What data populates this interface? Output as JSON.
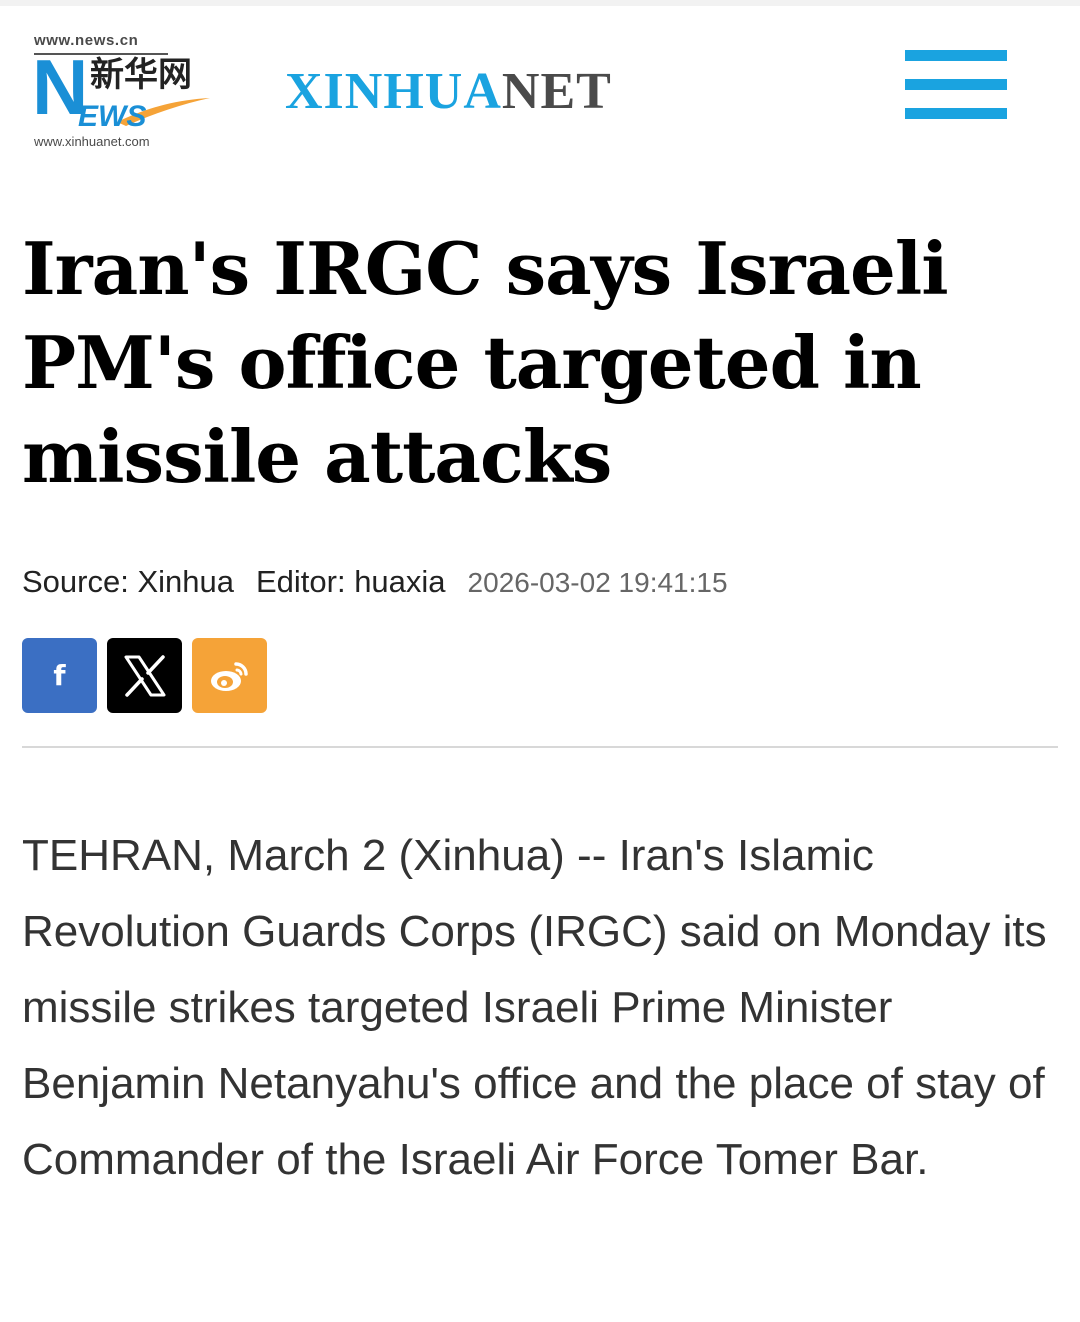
{
  "header": {
    "logo": {
      "url_top": "www.news.cn",
      "letter": "N",
      "chinese": "新华网",
      "ews": "EWS",
      "url_bottom": "www.xinhuanet.com"
    },
    "brand": {
      "part1": "XINHUA",
      "part2": "NET"
    },
    "menu_icon": "hamburger-menu-icon",
    "colors": {
      "accent": "#1aa3e0",
      "brand_gray": "#4a4a4a"
    }
  },
  "article": {
    "title": "Iran's IRGC says Israeli PM's office targeted in missile attacks",
    "source": "Source: Xinhua",
    "editor": "Editor: huaxia",
    "date": "2026-03-02 19:41:15",
    "body": "TEHRAN, March 2 (Xinhua) -- Iran's Islamic Revolution Guards Corps (IRGC) said on Monday its missile strikes targeted Israeli Prime Minister Benjamin Netanyahu's office and the place of stay of Commander of the Israeli Air Force Tomer Bar."
  },
  "share": [
    {
      "name": "facebook",
      "icon": "facebook-icon",
      "glyph": "f",
      "color": "#3b6fc3"
    },
    {
      "name": "x",
      "icon": "x-icon",
      "color": "#000000"
    },
    {
      "name": "weibo",
      "icon": "weibo-icon",
      "color": "#f5a338"
    }
  ]
}
